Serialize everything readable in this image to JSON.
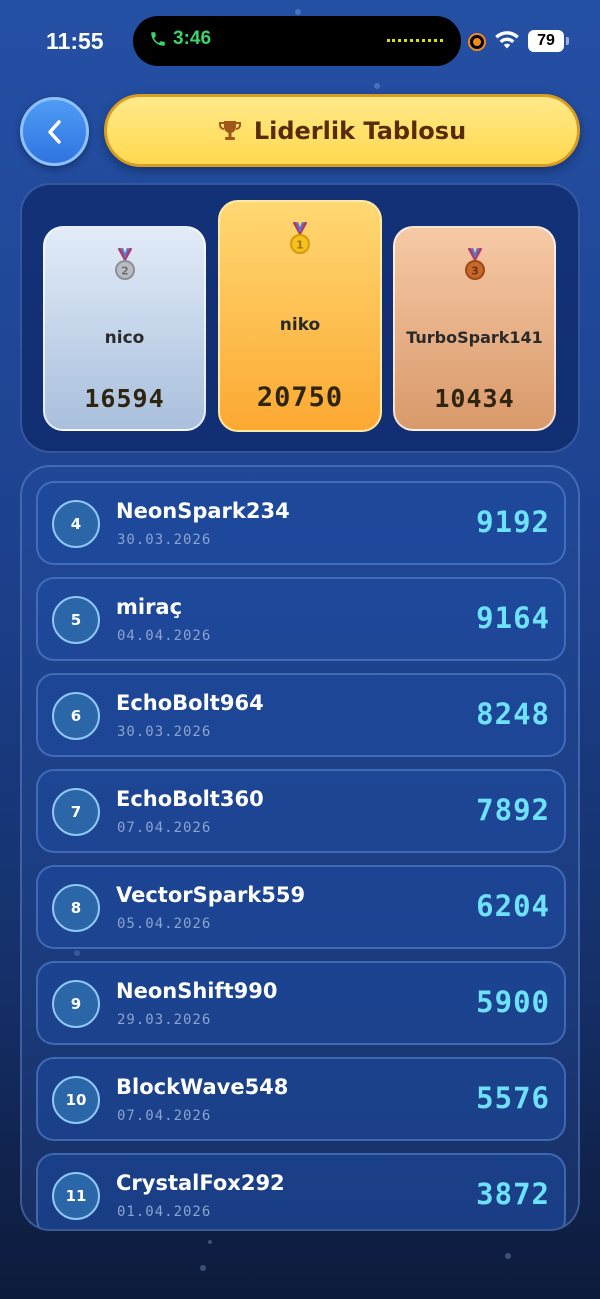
{
  "status_bar": {
    "time": "11:55",
    "call_time": "3:46",
    "battery": "79"
  },
  "header": {
    "title": "Liderlik Tablosu",
    "back_icon": "chevron-left-icon",
    "title_icon": "trophy-icon"
  },
  "podium": [
    {
      "place": 2,
      "medal": "silver-medal-icon",
      "name": "nico",
      "score": "16594"
    },
    {
      "place": 1,
      "medal": "gold-medal-icon",
      "name": "niko",
      "score": "20750"
    },
    {
      "place": 3,
      "medal": "bronze-medal-icon",
      "name": "TurboSpark141",
      "score": "10434"
    }
  ],
  "leaderboard": [
    {
      "rank": "4",
      "name": "NeonSpark234",
      "date": "30.03.2026",
      "score": "9192"
    },
    {
      "rank": "5",
      "name": "miraç",
      "date": "04.04.2026",
      "score": "9164"
    },
    {
      "rank": "6",
      "name": "EchoBolt964",
      "date": "30.03.2026",
      "score": "8248"
    },
    {
      "rank": "7",
      "name": "EchoBolt360",
      "date": "07.04.2026",
      "score": "7892"
    },
    {
      "rank": "8",
      "name": "VectorSpark559",
      "date": "05.04.2026",
      "score": "6204"
    },
    {
      "rank": "9",
      "name": "NeonShift990",
      "date": "29.03.2026",
      "score": "5900"
    },
    {
      "rank": "10",
      "name": "BlockWave548",
      "date": "07.04.2026",
      "score": "5576"
    },
    {
      "rank": "11",
      "name": "CrystalFox292",
      "date": "01.04.2026",
      "score": "3872"
    }
  ],
  "colors": {
    "accent_score": "#6ee2fb",
    "title_pill": "#ffd94f",
    "gold": "#fca932",
    "silver": "#a9bfdc",
    "bronze": "#d9996a"
  }
}
